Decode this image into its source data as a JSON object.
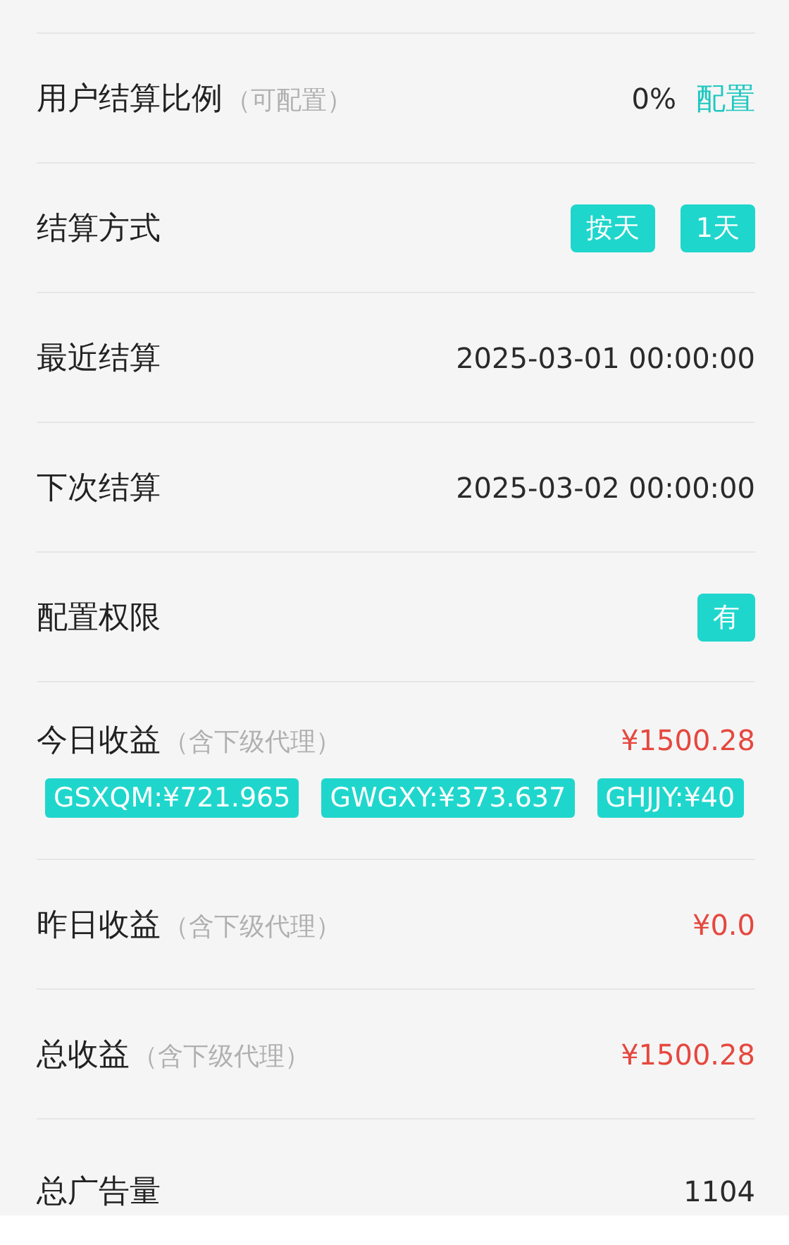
{
  "rows": [
    {
      "kind": "text",
      "label": "用户结算比例",
      "note": "（可配置）",
      "value": "0%",
      "link": "配置"
    },
    {
      "kind": "tags",
      "label": "结算方式",
      "tags": [
        "按天",
        "1天"
      ]
    },
    {
      "kind": "text",
      "label": "最近结算",
      "value": "2025-03-01 00:00:00"
    },
    {
      "kind": "text",
      "label": "下次结算",
      "value": "2025-03-02 00:00:00"
    },
    {
      "kind": "tags",
      "label": "配置权限",
      "tags": [
        "有"
      ]
    },
    {
      "kind": "amount",
      "label": "今日收益",
      "note": "（含下级代理）",
      "value": "¥1500.28",
      "chips": [
        "GSXQM:¥721.965",
        "GWGXY:¥373.637",
        "GHJJY:¥40"
      ]
    },
    {
      "kind": "amount",
      "label": "昨日收益",
      "note": "（含下级代理）",
      "value": "¥0.0"
    },
    {
      "kind": "amount",
      "label": "总收益",
      "note": "（含下级代理）",
      "value": "¥1500.28"
    },
    {
      "kind": "text",
      "label": "总广告量",
      "value": "1104"
    }
  ]
}
